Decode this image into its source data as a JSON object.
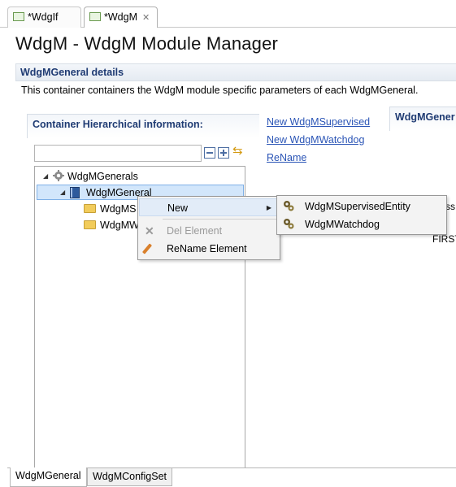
{
  "editor_tabs": [
    {
      "label": "*WdgIf",
      "active": false
    },
    {
      "label": "*WdgM",
      "active": true
    }
  ],
  "page": {
    "title": "WdgM - WdgM Module Manager"
  },
  "details": {
    "title": "WdgMGeneral details",
    "description": "This container containers the WdgM module specific parameters of each WdgMGeneral."
  },
  "hierarchy": {
    "title": "Container Hierarchical information:",
    "filter_value": "",
    "tree": {
      "root": "WdgMGenerals",
      "selected": "WdgMGeneral",
      "children": [
        "WdgMS",
        "WdgMW"
      ]
    }
  },
  "links": {
    "new_supervised": "New WdgMSupervised",
    "new_watchdog": "New WdgMWatchdog",
    "rename": "ReName"
  },
  "right_panel": {
    "title": "WdgMGener",
    "fragment_1": "ss",
    "fragment_2": "FIRST"
  },
  "context_menu": {
    "new": "New",
    "del": "Del Element",
    "rename": "ReName Element"
  },
  "submenu": {
    "items": [
      "WdgMSupervisedEntity",
      "WdgMWatchdog"
    ]
  },
  "bottom_tabs": [
    {
      "label": "WdgMGeneral",
      "active": true
    },
    {
      "label": "WdgMConfigSet",
      "active": false
    }
  ],
  "colors": {
    "section_title": "#1f3b73",
    "link": "#2b55b6",
    "selection": "#d2e6fb",
    "menu_highlight": "#e2ecf8"
  }
}
